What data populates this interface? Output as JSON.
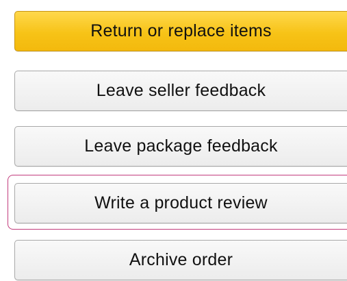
{
  "actions": {
    "return_or_replace": "Return or replace items",
    "seller_feedback": "Leave seller feedback",
    "package_feedback": "Leave package feedback",
    "product_review": "Write a product review",
    "archive_order": "Archive order"
  },
  "colors": {
    "primary_button": "#f7c317",
    "secondary_button": "#eeeeee",
    "focus_ring": "#c23b7c"
  }
}
